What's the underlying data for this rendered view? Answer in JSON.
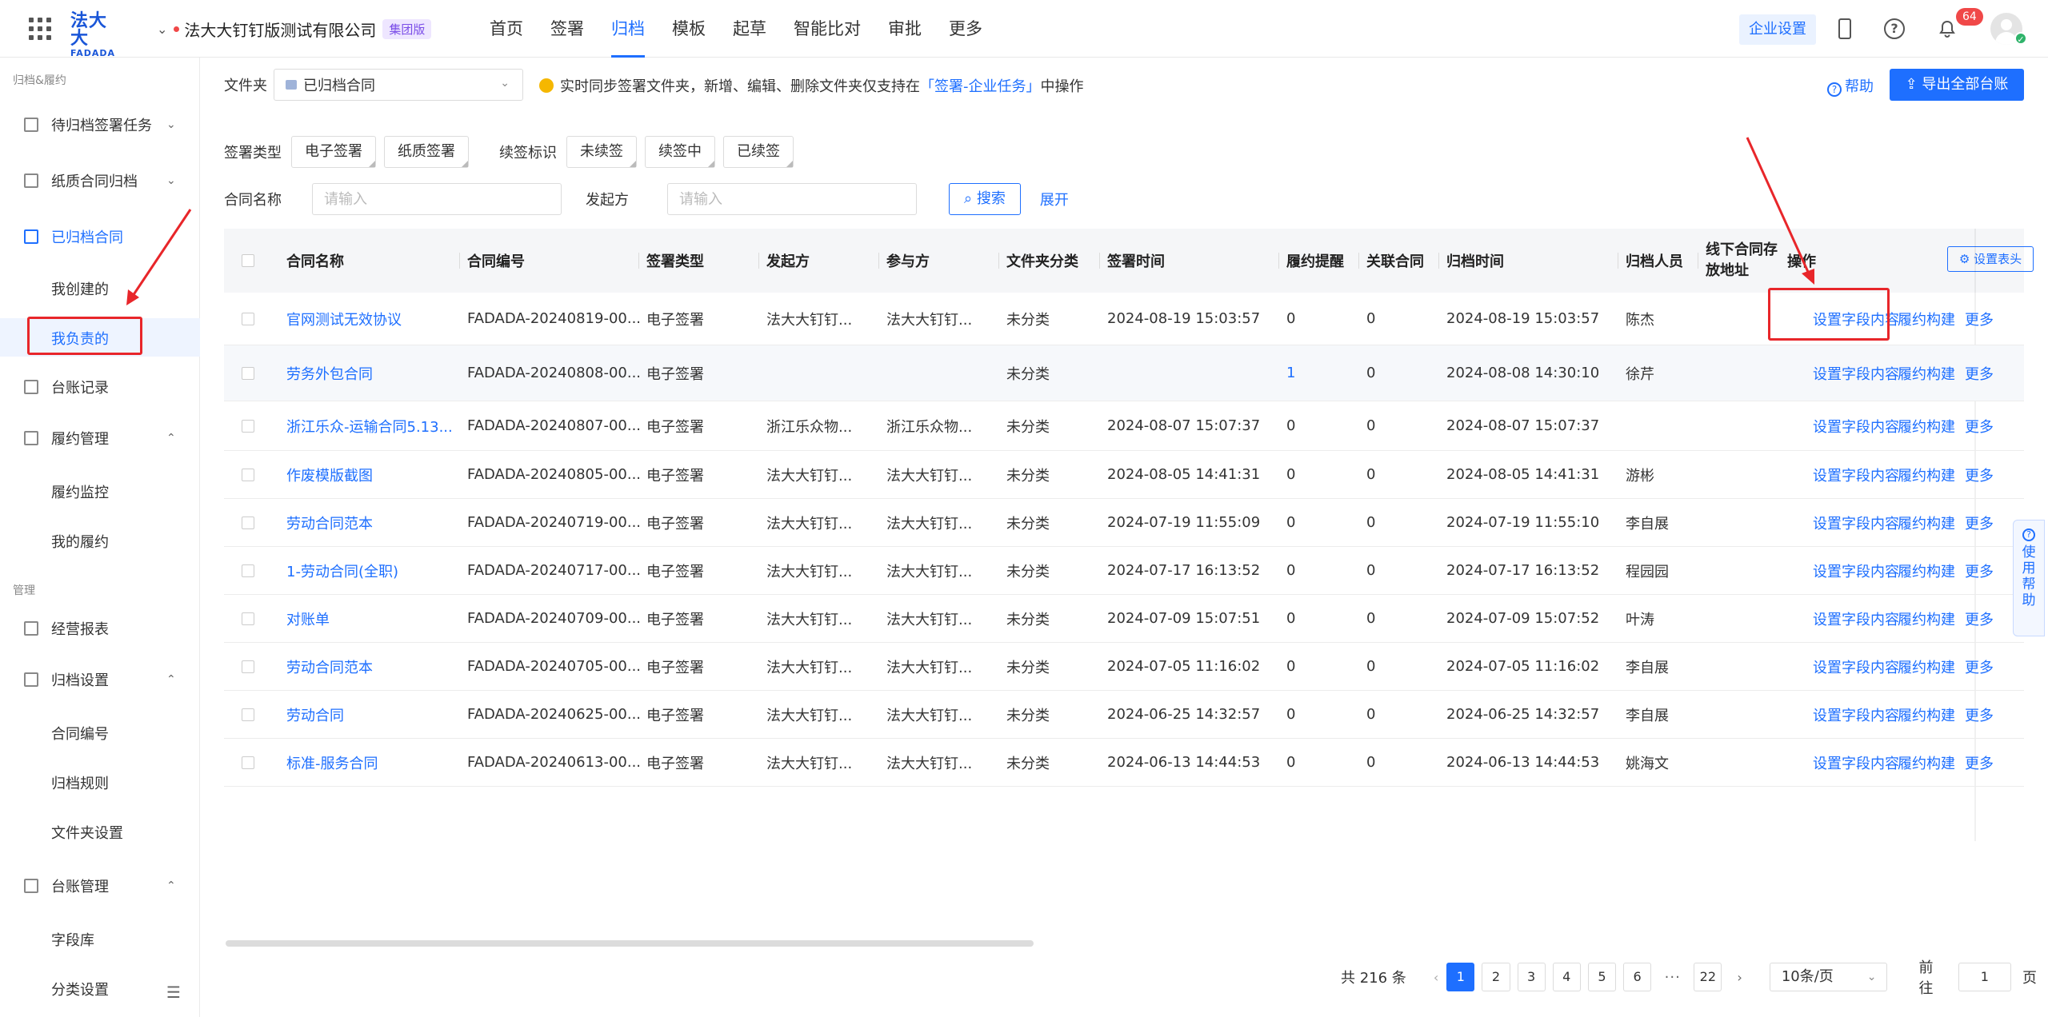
{
  "topbar": {
    "logo_cn": "法大大",
    "logo_en": "FADADA",
    "company": "法大大钉钉版测试有限公司",
    "company_badge": "集团版",
    "nav": [
      "首页",
      "签署",
      "归档",
      "模板",
      "起草",
      "智能比对",
      "审批",
      "更多"
    ],
    "active_nav": "归档",
    "enterprise_settings": "企业设置",
    "notification_count": "64",
    "help_glyph": "?"
  },
  "sidebar": {
    "section1": "归档&履约",
    "items": [
      {
        "label": "待归档签署任务",
        "icon": "folder-pending-icon"
      },
      {
        "label": "纸质合同归档",
        "icon": "paper-contract-icon"
      },
      {
        "label": "已归档合同",
        "icon": "archived-box-icon"
      },
      {
        "label": "我创建的"
      },
      {
        "label": "我负责的"
      },
      {
        "label": "台账记录",
        "icon": "ledger-icon"
      },
      {
        "label": "履约管理",
        "icon": "performance-icon"
      },
      {
        "label": "履约监控"
      },
      {
        "label": "我的履约"
      }
    ],
    "section2": "管理",
    "items2": [
      {
        "label": "经营报表",
        "icon": "chart-icon"
      },
      {
        "label": "归档设置",
        "icon": "archive-settings-icon"
      },
      {
        "label": "合同编号"
      },
      {
        "label": "归档规则"
      },
      {
        "label": "文件夹设置"
      },
      {
        "label": "台账管理",
        "icon": "ledger-manage-icon"
      },
      {
        "label": "字段库"
      },
      {
        "label": "分类设置"
      }
    ]
  },
  "toolbar": {
    "folder_label": "文件夹",
    "folder_value": "已归档合同",
    "notice_prefix": "实时同步签署文件夹，新增、编辑、删除文件夹仅支持在",
    "notice_link": "「签署-企业任务」",
    "notice_suffix": "中操作",
    "help": "帮助",
    "export": "导出全部台账"
  },
  "filters": {
    "sign_type_label": "签署类型",
    "sign_types": [
      "电子签署",
      "纸质签署"
    ],
    "renew_label": "续签标识",
    "renew_options": [
      "未续签",
      "续签中",
      "已续签"
    ],
    "contract_name_label": "合同名称",
    "contract_name_placeholder": "请输入",
    "initiator_label": "发起方",
    "initiator_placeholder": "请输入",
    "search": "搜索",
    "expand": "展开"
  },
  "table": {
    "headers": [
      "合同名称",
      "合同编号",
      "签署类型",
      "发起方",
      "参与方",
      "文件夹分类",
      "签署时间",
      "履约提醒",
      "关联合同",
      "归档时间",
      "归档人员",
      "线下合同存放地址",
      "操作"
    ],
    "set_header": "设置表头",
    "actions": [
      "设置字段内容",
      "履约构建",
      "更多"
    ],
    "rows": [
      {
        "name": "官网测试无效协议",
        "no": "FADADA-20240819-00...",
        "type": "电子签署",
        "initiator": "法大大钉钉...",
        "party": "法大大钉钉...",
        "folder": "未分类",
        "sign_time": "2024-08-19 15:03:57",
        "remind": "0",
        "related": "0",
        "archive_time": "2024-08-19 15:03:57",
        "archiver": "陈杰"
      },
      {
        "name": "劳务外包合同",
        "no": "FADADA-20240808-00...",
        "type": "电子签署",
        "initiator": "",
        "party": "",
        "folder": "未分类",
        "sign_time": "",
        "remind": "1",
        "related": "0",
        "archive_time": "2024-08-08 14:30:10",
        "archiver": "徐芹"
      },
      {
        "name": "浙江乐众-运输合同5.13...",
        "no": "FADADA-20240807-00...",
        "type": "电子签署",
        "initiator": "浙江乐众物...",
        "party": "浙江乐众物...",
        "folder": "未分类",
        "sign_time": "2024-08-07 15:07:37",
        "remind": "0",
        "related": "0",
        "archive_time": "2024-08-07 15:07:37",
        "archiver": ""
      },
      {
        "name": "作废模版截图",
        "no": "FADADA-20240805-00...",
        "type": "电子签署",
        "initiator": "法大大钉钉...",
        "party": "法大大钉钉...",
        "folder": "未分类",
        "sign_time": "2024-08-05 14:41:31",
        "remind": "0",
        "related": "0",
        "archive_time": "2024-08-05 14:41:31",
        "archiver": "游彬"
      },
      {
        "name": "劳动合同范本",
        "no": "FADADA-20240719-00...",
        "type": "电子签署",
        "initiator": "法大大钉钉...",
        "party": "法大大钉钉...",
        "folder": "未分类",
        "sign_time": "2024-07-19 11:55:09",
        "remind": "0",
        "related": "0",
        "archive_time": "2024-07-19 11:55:10",
        "archiver": "李自展"
      },
      {
        "name": "1-劳动合同(全职)",
        "no": "FADADA-20240717-00...",
        "type": "电子签署",
        "initiator": "法大大钉钉...",
        "party": "法大大钉钉...",
        "folder": "未分类",
        "sign_time": "2024-07-17 16:13:52",
        "remind": "0",
        "related": "0",
        "archive_time": "2024-07-17 16:13:52",
        "archiver": "程园园"
      },
      {
        "name": "对账单",
        "no": "FADADA-20240709-00...",
        "type": "电子签署",
        "initiator": "法大大钉钉...",
        "party": "法大大钉钉...",
        "folder": "未分类",
        "sign_time": "2024-07-09 15:07:51",
        "remind": "0",
        "related": "0",
        "archive_time": "2024-07-09 15:07:52",
        "archiver": "叶涛"
      },
      {
        "name": "劳动合同范本",
        "no": "FADADA-20240705-00...",
        "type": "电子签署",
        "initiator": "法大大钉钉...",
        "party": "法大大钉钉...",
        "folder": "未分类",
        "sign_time": "2024-07-05 11:16:02",
        "remind": "0",
        "related": "0",
        "archive_time": "2024-07-05 11:16:02",
        "archiver": "李自展"
      },
      {
        "name": "劳动合同",
        "no": "FADADA-20240625-00...",
        "type": "电子签署",
        "initiator": "法大大钉钉...",
        "party": "法大大钉钉...",
        "folder": "未分类",
        "sign_time": "2024-06-25 14:32:57",
        "remind": "0",
        "related": "0",
        "archive_time": "2024-06-25 14:32:57",
        "archiver": "李自展"
      },
      {
        "name": "标准-服务合同",
        "no": "FADADA-20240613-00...",
        "type": "电子签署",
        "initiator": "法大大钉钉...",
        "party": "法大大钉钉...",
        "folder": "未分类",
        "sign_time": "2024-06-13 14:44:53",
        "remind": "0",
        "related": "0",
        "archive_time": "2024-06-13 14:44:53",
        "archiver": "姚海文"
      }
    ]
  },
  "pagination": {
    "total": "共 216 条",
    "pages": [
      "1",
      "2",
      "3",
      "4",
      "5",
      "6"
    ],
    "ellipsis": "···",
    "last_page": "22",
    "current": "1",
    "page_size": "10条/页",
    "goto_label": "前往",
    "goto_value": "1",
    "goto_suffix": "页"
  },
  "floating_help": "使用帮助",
  "colors": {
    "primary": "#1e6fff",
    "annotation_red": "#e8262a",
    "badge_red": "#f04848",
    "group_badge": "#7b4ee8"
  }
}
